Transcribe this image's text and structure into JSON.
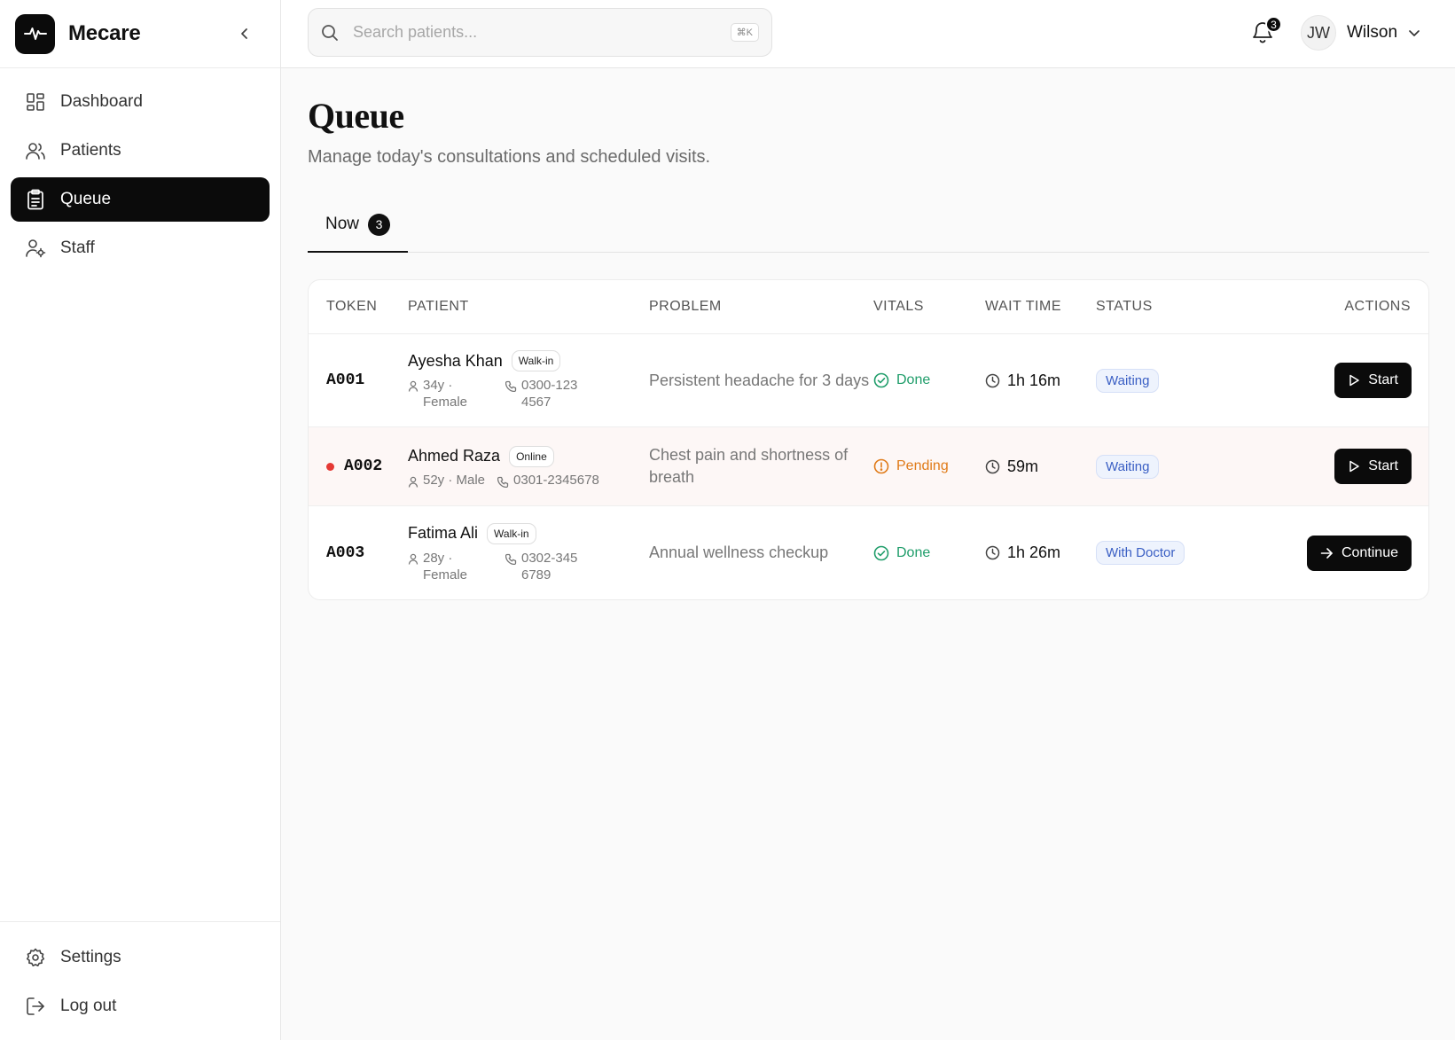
{
  "app": {
    "name": "Mecare"
  },
  "sidebar": {
    "items": [
      {
        "label": "Dashboard",
        "icon": "dashboard-icon"
      },
      {
        "label": "Patients",
        "icon": "users-icon"
      },
      {
        "label": "Queue",
        "icon": "clipboard-icon",
        "active": true
      },
      {
        "label": "Staff",
        "icon": "user-cog-icon"
      }
    ],
    "bottom": [
      {
        "label": "Settings",
        "icon": "gear-icon"
      },
      {
        "label": "Log out",
        "icon": "logout-icon"
      }
    ]
  },
  "header": {
    "search_placeholder": "Search patients...",
    "shortcut": "⌘K",
    "notification_count": "3",
    "user_initials": "JW",
    "user_name": "Wilson"
  },
  "page": {
    "title": "Queue",
    "subtitle": "Manage today's consultations and scheduled visits.",
    "tab": {
      "label": "Now",
      "count": "3"
    }
  },
  "table": {
    "headers": {
      "token": "TOKEN",
      "patient": "PATIENT",
      "problem": "PROBLEM",
      "vitals": "VITALS",
      "wait": "WAIT TIME",
      "status": "STATUS",
      "actions": "ACTIONS"
    },
    "rows": [
      {
        "token": "A001",
        "name": "Ayesha Khan",
        "type": "Walk-in",
        "demo": "34y · Female",
        "phone": "0300-1234567",
        "problem": "Persistent headache for 3 days",
        "vitals": "Done",
        "wait": "1h 16m",
        "status": "Waiting",
        "action": "Start"
      },
      {
        "token": "A002",
        "name": "Ahmed Raza",
        "type": "Online",
        "demo": "52y · Male",
        "phone": "0301-2345678",
        "problem": "Chest pain and shortness of breath",
        "vitals": "Pending",
        "wait": "59m",
        "status": "Waiting",
        "action": "Start"
      },
      {
        "token": "A003",
        "name": "Fatima Ali",
        "type": "Walk-in",
        "demo": "28y · Female",
        "phone": "0302-3456789",
        "problem": "Annual wellness checkup",
        "vitals": "Done",
        "wait": "1h 26m",
        "status": "With Doctor",
        "action": "Continue"
      }
    ]
  },
  "colors": {
    "done": "#1f9d6a",
    "pending": "#e07b19",
    "status_text": "#3a5fc4",
    "alert_dot": "#e53935"
  }
}
